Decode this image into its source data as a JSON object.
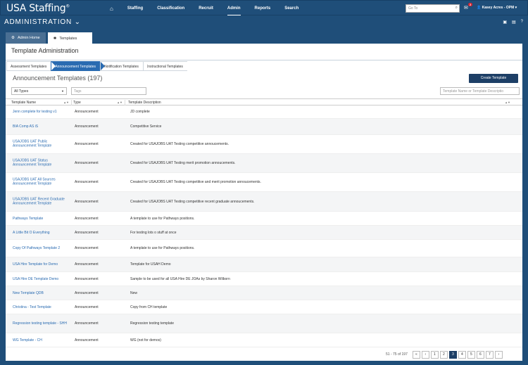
{
  "app": {
    "logo": "USA Staffing",
    "logo_mark": "®"
  },
  "nav": {
    "home_icon": "home-icon",
    "items": [
      {
        "label": "Staffing"
      },
      {
        "label": "Classification"
      },
      {
        "label": "Recruit"
      },
      {
        "label": "Admin",
        "active": true
      },
      {
        "label": "Reports"
      },
      {
        "label": "Search"
      }
    ],
    "goto_placeholder": "Go To",
    "mail_count": "2",
    "user": "Kasey Acres - OPM"
  },
  "header": {
    "title": "ADMINISTRATION"
  },
  "tabs": [
    {
      "label": "Admin Home",
      "icon": "gear-icon"
    },
    {
      "label": "Templates",
      "icon": "puzzle-icon",
      "active": true
    }
  ],
  "panel": {
    "title": "Template Administration"
  },
  "crumbs": [
    {
      "label": "Assessment Templates"
    },
    {
      "label": "Announcement Templates",
      "active": true
    },
    {
      "label": "Notification Templates"
    },
    {
      "label": "Instructional Templates"
    }
  ],
  "section": {
    "title": "Announcement Templates (197)",
    "create_label": "Create Template"
  },
  "filters": {
    "type_value": "All Types",
    "tags_placeholder": "Tags",
    "search_placeholder": "Template Name or Template Descriptio"
  },
  "table": {
    "headers": [
      "Template Name",
      "Type",
      "Template Description"
    ],
    "rows": [
      {
        "name": "Jenn complete for testing v1",
        "type": "Announcement",
        "desc": "JD complete"
      },
      {
        "name": "BIA Comp AS iS",
        "type": "Announcement",
        "desc": "Competitive Service"
      },
      {
        "name": "USAJOBS UAT Public Announcement Template",
        "type": "Announcement",
        "desc": "Created for USAJOBS UAT Testing competitive annoucements."
      },
      {
        "name": "USAJOBS UAT Status Announcement Template",
        "type": "Announcement",
        "desc": "Created for USAJOBS UAT Testing merit promotion annoucements."
      },
      {
        "name": "USAJOBS UAT All Sources Announcement Template",
        "type": "Announcement",
        "desc": "Created for USAJOBS UAT Testing competitive and merit promotion annoucements."
      },
      {
        "name": "USAJOBS UAT Recent Graduate Announcement Template",
        "type": "Announcement",
        "desc": "Created for USAJOBS UAT Testing competitive recent graduate annoucements."
      },
      {
        "name": "Pathways Template",
        "type": "Announcement",
        "desc": "A template to use for Pathways positions."
      },
      {
        "name": "A Little Bit O Everything",
        "type": "Announcement",
        "desc": "For testing lots o stuff at once"
      },
      {
        "name": "Copy Of Pathways Template 2",
        "type": "Announcement",
        "desc": "A template to use for Pathways positions."
      },
      {
        "name": "USA Hire Template for Demo",
        "type": "Announcement",
        "desc": "Template for USAH Demo"
      },
      {
        "name": "USA Hire DE Template Demo",
        "type": "Announcement",
        "desc": "Sample to be used for all USA Hire DE JOAs by Sharon Wilborn"
      },
      {
        "name": "New Template QDB",
        "type": "Announcement",
        "desc": "New"
      },
      {
        "name": "Christina - Test Template",
        "type": "Announcement",
        "desc": "Copy from CH template"
      },
      {
        "name": "Regression testing template - SHH",
        "type": "Announcement",
        "desc": "Regression testing template"
      },
      {
        "name": "WG Template - CH",
        "type": "Announcement",
        "desc": "WG (not for demos)"
      }
    ]
  },
  "pager": {
    "count": "51 - 75 of 197",
    "pages": [
      "«",
      "‹",
      "1",
      "2",
      "3",
      "4",
      "5",
      "6",
      "7",
      "›"
    ],
    "current": "3"
  }
}
